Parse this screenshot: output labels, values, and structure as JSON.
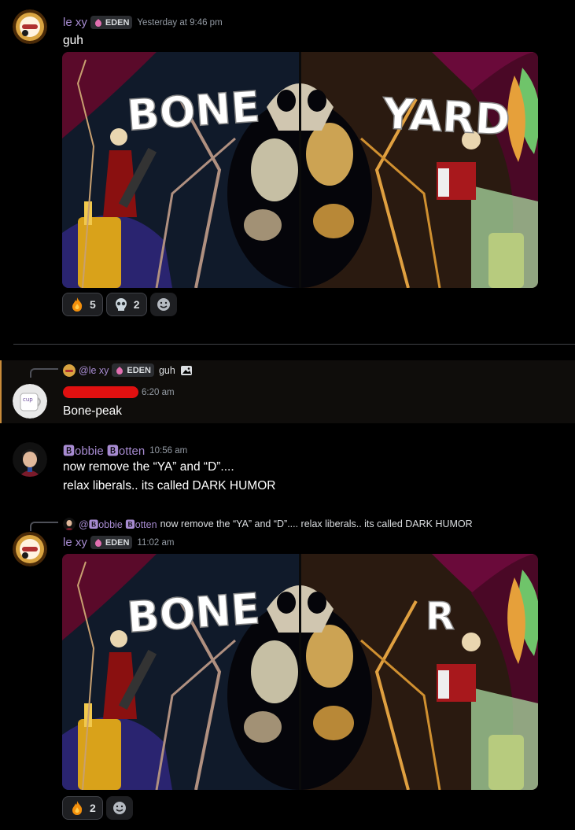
{
  "messages": [
    {
      "author": "le xy",
      "author_color": "#a78bd1",
      "tag": "EDEN",
      "timestamp": "Yesterday at 9:46 pm",
      "text": "guh",
      "image": {
        "left_word": "BONE",
        "right_word": "YARD"
      },
      "reactions": [
        {
          "emoji": "fire-emoji",
          "count": "5"
        },
        {
          "emoji": "skull-emoji",
          "count": "2"
        }
      ]
    },
    {
      "reply": {
        "author": "@le xy",
        "tag": "EDEN",
        "text": "guh",
        "has_image_icon": true
      },
      "author": "",
      "author_redacted": true,
      "timestamp": "6:20 am",
      "text": "Bone-peak",
      "highlight_color": "#c98b3a"
    },
    {
      "author": "🅱obbie 🅱otten",
      "author_color": "#a78bd1",
      "timestamp": "10:56 am",
      "lines": [
        "now remove the “YA” and “D”....",
        "relax liberals.. its called DARK HUMOR"
      ]
    },
    {
      "reply": {
        "author": "@🅱obbie 🅱otten",
        "text": "now remove the “YA” and “D”.... relax liberals.. its called DARK HUMOR"
      },
      "author": "le xy",
      "author_color": "#a78bd1",
      "tag": "EDEN",
      "timestamp": "11:02 am",
      "image": {
        "left_word": "BONE",
        "right_word": "R"
      },
      "reactions": [
        {
          "emoji": "fire-emoji",
          "count": "2"
        }
      ]
    }
  ],
  "add_reaction_icon": "add-reaction-icon",
  "tag_icon": "pink-gem-icon",
  "image_icon": "image-icon"
}
